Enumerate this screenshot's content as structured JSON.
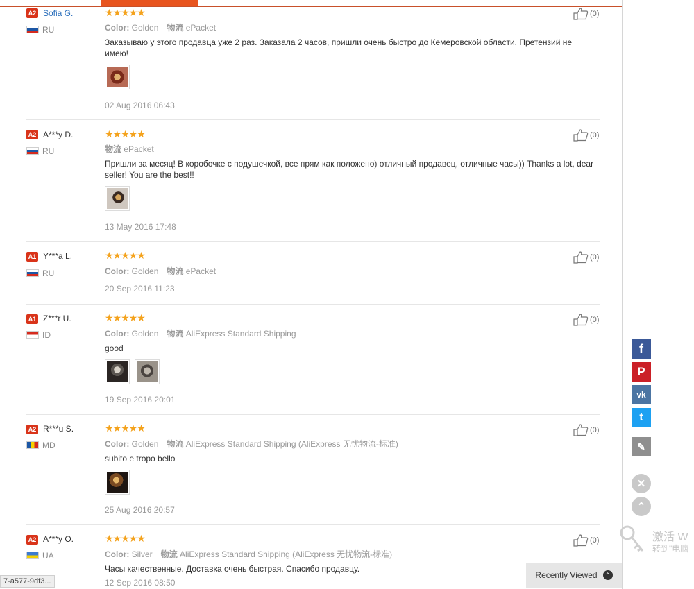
{
  "reviews": [
    {
      "level": "A2",
      "name": "Sofia G.",
      "country": "RU",
      "flag": "ru",
      "stars": "★★★★★",
      "color_label": "Color:",
      "color_value": "Golden",
      "ship_label": "物流",
      "ship_value": "ePacket",
      "text": "Заказываю у этого продавца уже 2 раз. Заказала 2 часов, пришли очень быстро до Кемеровской области. Претензий не имею!",
      "date": "02 Aug 2016 06:43",
      "helpful": "(0)"
    },
    {
      "level": "A2",
      "name": "A***y D.",
      "country": "RU",
      "flag": "ru",
      "stars": "★★★★★",
      "ship_label": "物流",
      "ship_value": "ePacket",
      "text": "Пришли за месяц! В коробочке с подушечкой, все прям как положено) отличный продавец, отличные часы)) Thanks a lot, dear seller! You are the best!!",
      "date": "13 May 2016 17:48",
      "helpful": "(0)"
    },
    {
      "level": "A1",
      "name": "Y***a L.",
      "country": "RU",
      "flag": "ru",
      "stars": "★★★★★",
      "color_label": "Color:",
      "color_value": "Golden",
      "ship_label": "物流",
      "ship_value": "ePacket",
      "date": "20 Sep 2016 11:23",
      "helpful": "(0)"
    },
    {
      "level": "A1",
      "name": "Z***r U.",
      "country": "ID",
      "flag": "id",
      "stars": "★★★★★",
      "color_label": "Color:",
      "color_value": "Golden",
      "ship_label": "物流",
      "ship_value": "AliExpress Standard Shipping",
      "text": "good",
      "date": "19 Sep 2016 20:01",
      "helpful": "(0)"
    },
    {
      "level": "A2",
      "name": "R***u S.",
      "country": "MD",
      "flag": "md",
      "stars": "★★★★★",
      "color_label": "Color:",
      "color_value": "Golden",
      "ship_label": "物流",
      "ship_value": "AliExpress Standard Shipping (AliExpress 无忧物流-标准)",
      "text": "subito e tropo bello",
      "date": "25 Aug 2016 20:57",
      "helpful": "(0)"
    },
    {
      "level": "A2",
      "name": "A***y O.",
      "country": "UA",
      "flag": "ua",
      "stars": "★★★★★",
      "color_label": "Color:",
      "color_value": "Silver",
      "ship_label": "物流",
      "ship_value": "AliExpress Standard Shipping (AliExpress 无忧物流-标准)",
      "text": "Часы качественные. Доставка очень быстрая. Спасибо продавцу.",
      "date": "12 Sep 2016 08:50",
      "helpful": "(0)"
    }
  ],
  "share": {
    "facebook": "f",
    "pinterest": "P",
    "vk": "vk",
    "twitter": "t",
    "edit": "✎"
  },
  "controls": {
    "close": "✕",
    "up": "⌃"
  },
  "recently_viewed": {
    "label": "Recently Viewed",
    "icon": "⌃"
  },
  "status_url": "7-a577-9df3...",
  "watermark": {
    "line1": "激活 W",
    "line2": "转到\"电脑"
  },
  "colors": {
    "accent": "#e8541e",
    "star": "#f4a21c",
    "badge": "#d9341a",
    "link": "#2a6ebb",
    "facebook": "#3b5998",
    "pinterest": "#cb2027",
    "vk": "#4c75a3",
    "twitter": "#1da1f2"
  }
}
